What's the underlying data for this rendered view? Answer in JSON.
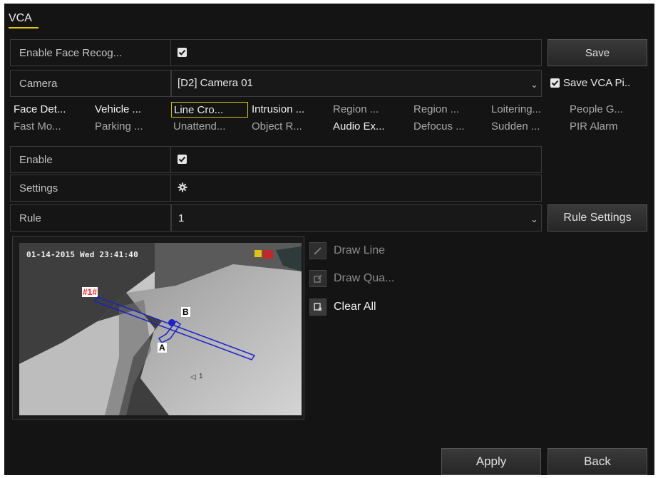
{
  "app": {
    "title": "VCA"
  },
  "face": {
    "label": "Enable Face Recog...",
    "checked": true
  },
  "save_label": "Save",
  "camera": {
    "label": "Camera",
    "value": "[D2] Camera 01",
    "save_pic_label": "Save VCA Pi..",
    "save_pic_checked": true
  },
  "tabs_row1": [
    "Face Det...",
    "Vehicle ...",
    "Line Cro...",
    "Intrusion ...",
    "Region ...",
    "Region ...",
    "Loitering...",
    "People G..."
  ],
  "tabs_row2": [
    "Fast Mo...",
    "Parking ...",
    "Unattend...",
    "Object R...",
    "Audio Ex...",
    "Defocus ...",
    "Sudden ...",
    "PIR Alarm"
  ],
  "enable": {
    "label": "Enable",
    "checked": true
  },
  "settings": {
    "label": "Settings",
    "icon": "gear-icon"
  },
  "rule": {
    "label": "Rule",
    "value": "1",
    "button": "Rule Settings"
  },
  "video": {
    "timestamp": "01-14-2015 Wed 23:41:40",
    "rule_tag": "#1#",
    "point_a": "A",
    "point_b": "B",
    "small_label": "1"
  },
  "tools": {
    "draw_line": "Draw Line",
    "draw_quad": "Draw Qua...",
    "clear_all": "Clear All"
  },
  "footer": {
    "apply": "Apply",
    "back": "Back"
  },
  "colors": {
    "accent": "#d8c40a",
    "panel": "#141414",
    "line_overlay": "#1a22c8",
    "tag_red": "#ff1a1a"
  }
}
